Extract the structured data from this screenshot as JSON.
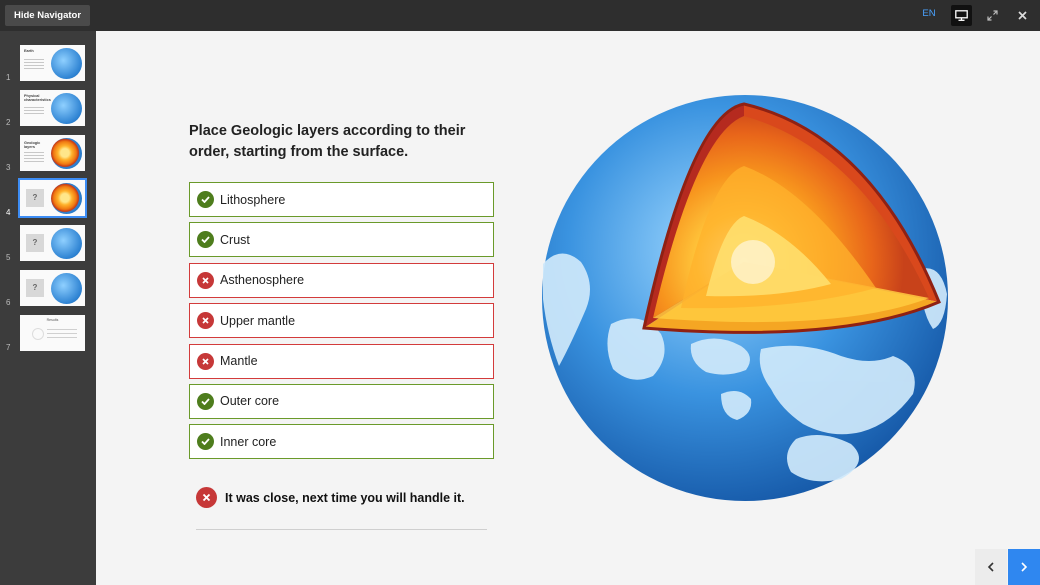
{
  "toolbar": {
    "hide_navigator_label": "Hide Navigator",
    "language": "EN",
    "icons": [
      "presentation-icon",
      "fullscreen-icon",
      "close-icon"
    ]
  },
  "navigator": {
    "slides": [
      {
        "number": "1",
        "type": "globe",
        "title": "Earth"
      },
      {
        "number": "2",
        "type": "globe",
        "title": "Physical characteristics"
      },
      {
        "number": "3",
        "type": "core",
        "title": "Geologic layers"
      },
      {
        "number": "4",
        "type": "question-core",
        "mark": "?",
        "active": true
      },
      {
        "number": "5",
        "type": "question-globe",
        "mark": "?"
      },
      {
        "number": "6",
        "type": "question-globe",
        "mark": "?"
      },
      {
        "number": "7",
        "type": "results",
        "title": "Results"
      }
    ]
  },
  "question": {
    "prompt": "Place Geologic layers according to their order, starting from the surface.",
    "answers": [
      {
        "label": "Lithosphere",
        "status": "correct"
      },
      {
        "label": "Crust",
        "status": "correct"
      },
      {
        "label": "Asthenosphere",
        "status": "wrong"
      },
      {
        "label": "Upper mantle",
        "status": "wrong"
      },
      {
        "label": "Mantle",
        "status": "wrong"
      },
      {
        "label": "Outer core",
        "status": "correct"
      },
      {
        "label": "Inner core",
        "status": "correct"
      }
    ],
    "feedback": "It was close, next time you will handle it."
  },
  "colors": {
    "correct": "#4e7d1d",
    "wrong": "#c63838",
    "accent": "#2f87f0"
  }
}
